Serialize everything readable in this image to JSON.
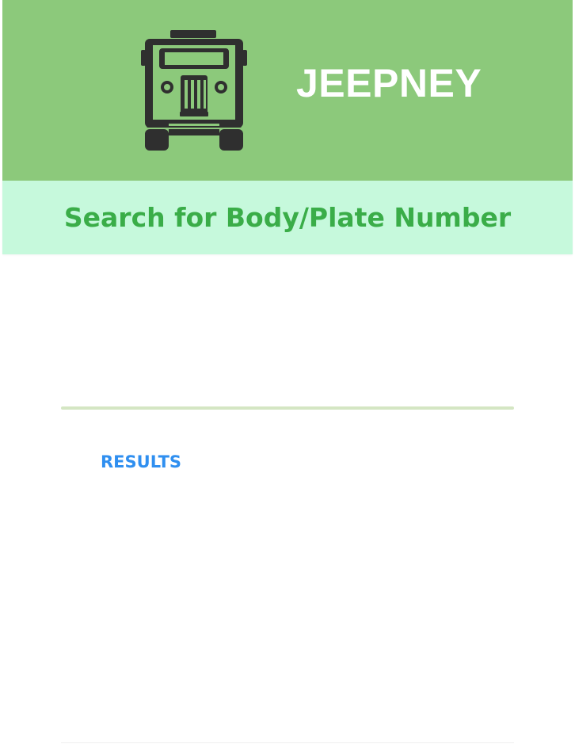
{
  "header": {
    "logo_icon": "jeepney-icon",
    "title": "JEEPNEY",
    "background_color": "#8cc97b"
  },
  "search": {
    "label": "Search for Body/Plate Number",
    "background_color": "#c6f9dc",
    "text_color": "#3aad48"
  },
  "results": {
    "label": "RESULTS",
    "label_color": "#2f8ff0",
    "items": []
  }
}
